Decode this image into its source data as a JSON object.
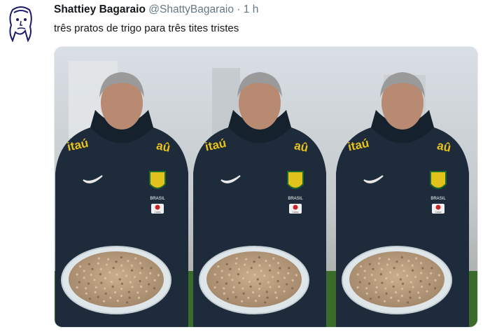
{
  "tweet": {
    "display_name": "Shattiey Bagaraio",
    "handle": "@ShattyBagaraio",
    "separator": "·",
    "time": "1 h",
    "text": "três pratos de trigo para três tites tristes"
  },
  "media": {
    "figures": [
      {
        "sponsor": "itaú",
        "sponsor_right": "aû",
        "crest": "BRASIL",
        "patch": "Caixa"
      },
      {
        "sponsor": "itaú",
        "sponsor_right": "aû",
        "crest": "BRASIL",
        "patch": "Caixa"
      },
      {
        "sponsor": "itaú",
        "sponsor_right": "aû",
        "crest": "BRASIL",
        "patch": "Caixa"
      }
    ]
  },
  "colors": {
    "jacket": "#1d2b3b",
    "sponsor_yellow": "#e9c21b",
    "grain": "#b79a78",
    "plate": "#dfe6ea",
    "grass": "#2f6a23"
  }
}
